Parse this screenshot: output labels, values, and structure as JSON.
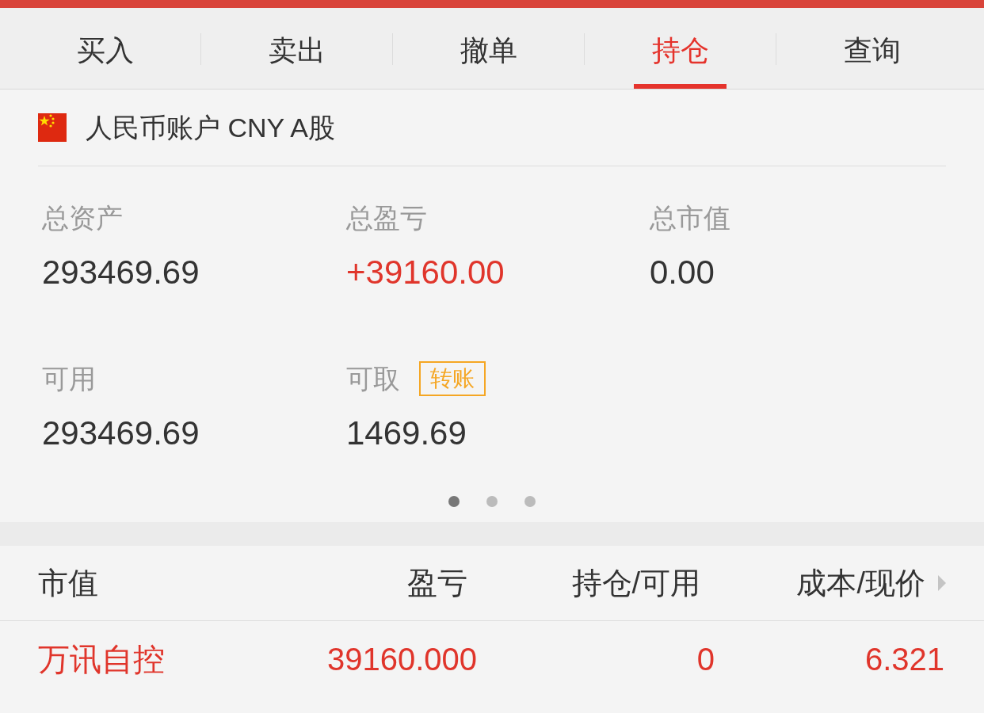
{
  "tabs": [
    {
      "label": "买入",
      "selected": false
    },
    {
      "label": "卖出",
      "selected": false
    },
    {
      "label": "撤单",
      "selected": false
    },
    {
      "label": "持仓",
      "selected": true
    },
    {
      "label": "查询",
      "selected": false
    }
  ],
  "account": {
    "title": "人民币账户 CNY A股"
  },
  "summary": [
    {
      "label": "总资产",
      "value": "293469.69",
      "kind": "plain"
    },
    {
      "label": "总盈亏",
      "value": "+39160.00",
      "kind": "gain"
    },
    {
      "label": "总市值",
      "value": "0.00",
      "kind": "plain"
    },
    {
      "label": "可用",
      "value": "293469.69",
      "kind": "plain"
    },
    {
      "label": "可取",
      "value": "1469.69",
      "kind": "plain",
      "action": "转账"
    }
  ],
  "pager": [
    {
      "selected": true
    },
    {
      "selected": false
    },
    {
      "selected": false
    }
  ],
  "holdings": {
    "columns": [
      "市值",
      "盈亏",
      "持仓/可用",
      "成本/现价"
    ],
    "rows": [
      {
        "kind": "gain",
        "cells": [
          "万讯自控",
          "39160.000",
          "0",
          "6.321"
        ]
      }
    ]
  }
}
